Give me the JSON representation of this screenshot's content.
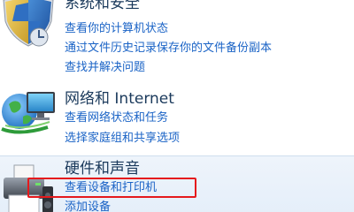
{
  "categories": [
    {
      "title": "系统和安全",
      "icon": "shield-icon",
      "links": [
        "查看你的计算机状态",
        "通过文件历史记录保存你的文件备份副本",
        "查找并解决问题"
      ]
    },
    {
      "title": "网络和 Internet",
      "icon": "network-globe-icon",
      "links": [
        "查看网络状态和任务",
        "选择家庭组和共享选项"
      ]
    },
    {
      "title": "硬件和声音",
      "icon": "printer-icon",
      "links": [
        "查看设备和打印机",
        "添加设备"
      ]
    }
  ],
  "colors": {
    "link": "#1a63c6",
    "title": "#1b3a5c",
    "highlight": "#e5191c",
    "hover_background": "#e8f1fb"
  }
}
